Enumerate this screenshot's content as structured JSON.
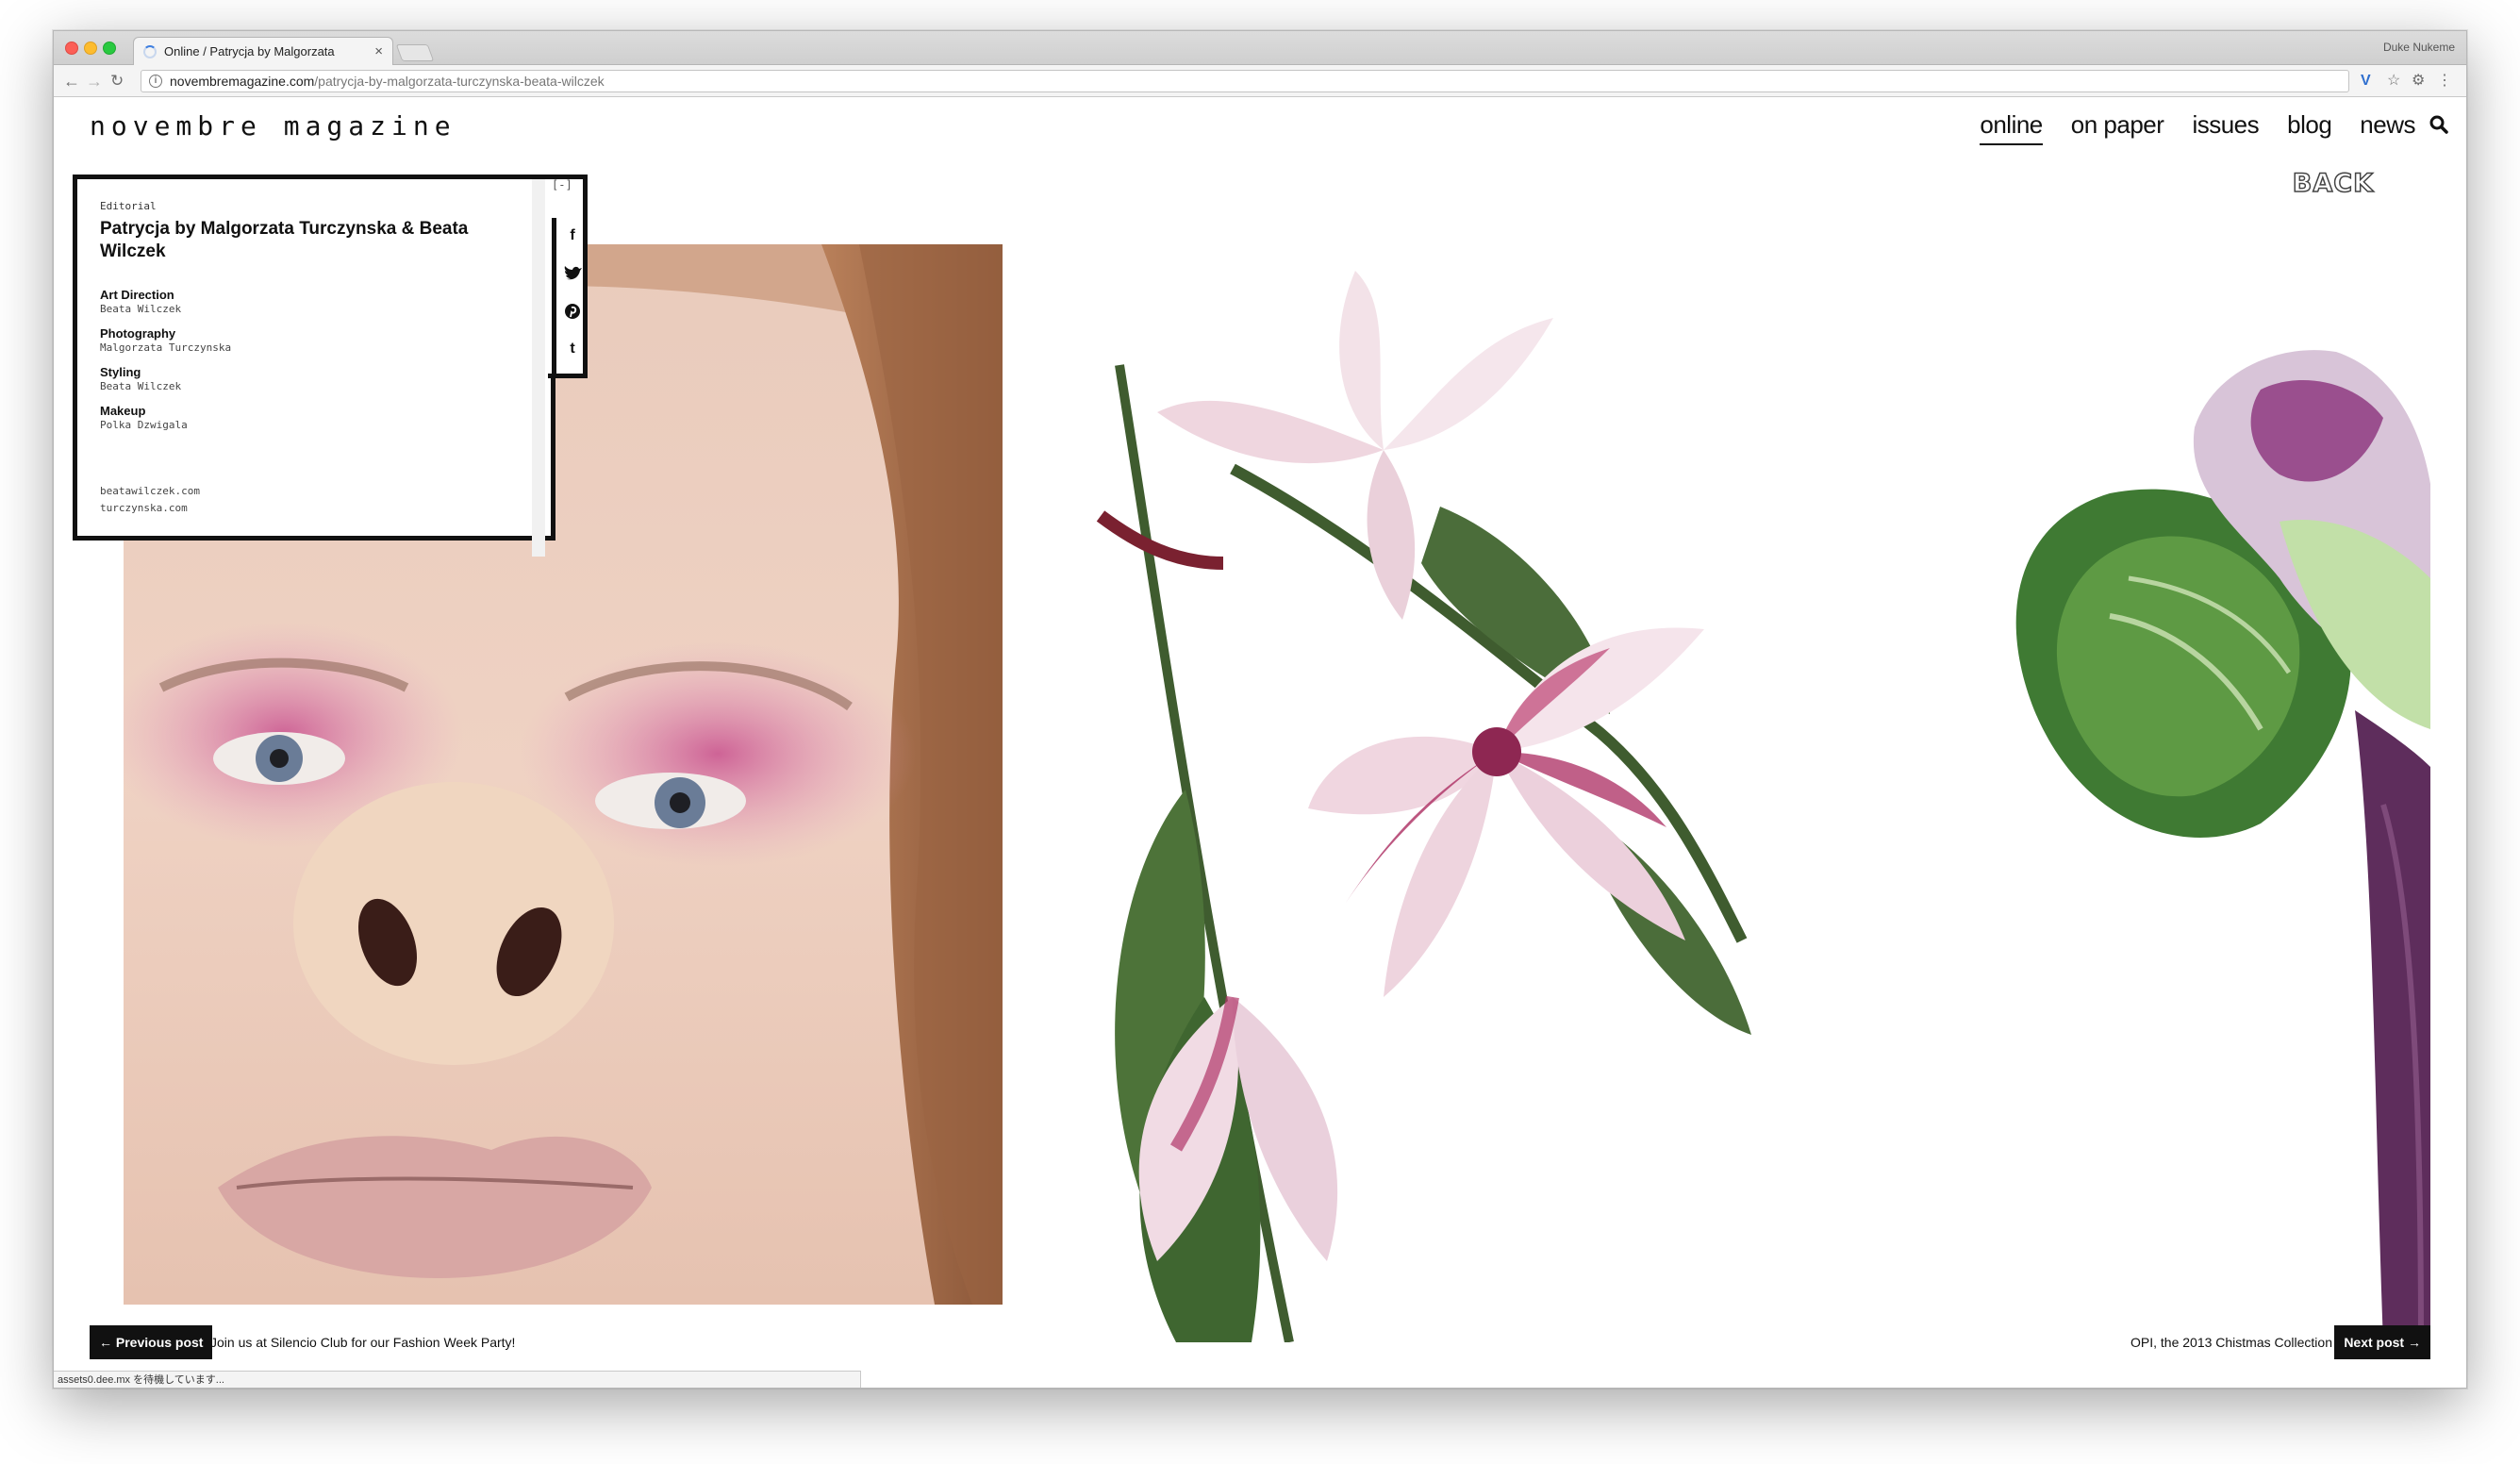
{
  "browser": {
    "tab_title": "Online / Patrycja by Malgorzata",
    "user_name": "Duke Nukeme",
    "url_domain": "novembremagazine.com",
    "url_path": "/patrycja-by-malgorzata-turczynska-beata-wilczek",
    "status_text": "assets0.dee.mx を待機しています..."
  },
  "site": {
    "logo": "novembre magazine",
    "nav": [
      {
        "label": "online",
        "active": true
      },
      {
        "label": "on paper",
        "active": false
      },
      {
        "label": "issues",
        "active": false
      },
      {
        "label": "blog",
        "active": false
      },
      {
        "label": "news",
        "active": false
      }
    ],
    "back_label": "BACK"
  },
  "article": {
    "category": "Editorial",
    "title": "Patrycja by Malgorzata Turczynska & Beata Wilczek",
    "collapse_label": "[-]",
    "credits": [
      {
        "role": "Art Direction",
        "name": "Beata Wilczek"
      },
      {
        "role": "Photography",
        "name": "Malgorzata Turczynska"
      },
      {
        "role": "Styling",
        "name": "Beata Wilczek"
      },
      {
        "role": "Makeup",
        "name": "Polka Dzwigala"
      }
    ],
    "links": [
      "beatawilczek.com",
      "turczynska.com"
    ],
    "share": [
      "f",
      "twitter",
      "pinterest",
      "t"
    ]
  },
  "pager": {
    "prev_label": "← Previous post",
    "prev_title": "Join us at Silencio Club for our Fashion Week Party!",
    "next_label": "Next post →",
    "next_title": "OPI, the 2013 Chistmas Collection"
  },
  "colors": {
    "accent": "#111111",
    "lily_pink": "#b0386a",
    "eyeshadow": "#d35f9c"
  }
}
